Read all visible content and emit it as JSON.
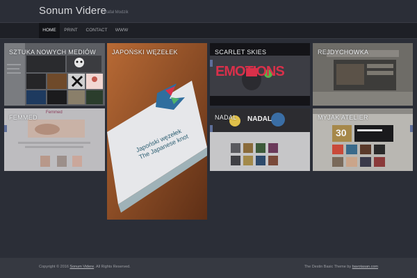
{
  "header": {
    "site_title": "Sonum Videre",
    "tagline": "Rafał Modzik"
  },
  "nav": {
    "items": [
      {
        "label": "HOME",
        "active": true
      },
      {
        "label": "PRINT",
        "active": false
      },
      {
        "label": "CONTACT",
        "active": false
      },
      {
        "label": "WWW",
        "active": false
      }
    ]
  },
  "portfolio": {
    "items": [
      {
        "title": "SZTUKA NOWYCH MEDIÓW"
      },
      {
        "title": "JAPOŃSKI WĘZEŁEK"
      },
      {
        "title": "SCARLET SKIES"
      },
      {
        "title": "REJDYCHOWKA"
      },
      {
        "title": "FEMMED"
      },
      {
        "title": "NADAL"
      },
      {
        "title": "MYJAK ATELIER"
      }
    ],
    "book_cover": {
      "line1": "Japoński węzełek",
      "line2": "The Japanese knot"
    },
    "emotions_word": "EMOTIONS",
    "nadal_logo": "NADAL",
    "femmed_logo": "Femmed",
    "myjak_number": "30"
  },
  "footer": {
    "copyright_prefix": "Copyright © 2016",
    "copyright_link": "Sonum Videre",
    "copyright_suffix": ". All Rights Reserved.",
    "credit_prefix": "The Destin Basic Theme by",
    "credit_link": "bavotasan.com"
  },
  "colors": {
    "background": "#2b2e37",
    "navbar": "#1e2026",
    "footer": "#363941",
    "emotions_red": "#d9304a"
  }
}
